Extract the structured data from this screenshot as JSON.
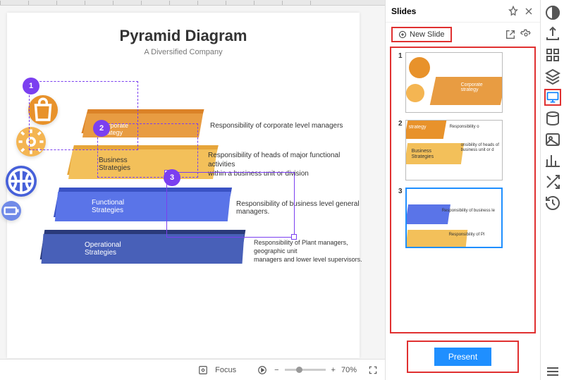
{
  "canvas": {
    "title": "Pyramid Diagram",
    "subtitle": "A Diversified Company",
    "levels": [
      {
        "label": "Corporate\nstrategy",
        "desc": "Responsibility of corporate level managers"
      },
      {
        "label": "Business\nStrategies",
        "desc": "Responsibility of heads of major functional activities\nwithin a business unit or division"
      },
      {
        "label": "Functional\nStrategies",
        "desc": "Responsibility of business level general managers."
      },
      {
        "label": "Operational\nStrategies",
        "desc": "Responsibility of Plant managers, geographic unit\nmanagers and lower level supervisors."
      }
    ],
    "selection_numbers": [
      "1",
      "2",
      "3"
    ]
  },
  "statusbar": {
    "focus_label": "Focus",
    "zoom_label": "70%"
  },
  "sidepanel": {
    "title": "Slides",
    "new_slide": "New Slide",
    "present_label": "Present",
    "thumbs": [
      {
        "num": "1",
        "t1_b1": "Corporate\nstrategy"
      },
      {
        "num": "2",
        "t2_b1": "strategy",
        "t2_b2": "Business\nStrategies",
        "t2_d1": "Responsibility o",
        "t2_d2": "onsibility of heads of\nbusiness unit or d"
      },
      {
        "num": "3",
        "t3_d1": "Responsibility of business le",
        "t3_d2": "Responsibility of Pl"
      }
    ]
  },
  "icons": {
    "bag": "bag",
    "gear": "gear",
    "basketball": "basketball",
    "battery": "battery",
    "pin": "pin",
    "close": "close",
    "share": "share",
    "settings": "settings",
    "diamond": "diamond",
    "export": "export",
    "grid": "grid",
    "layers": "layers",
    "slideshow": "slideshow",
    "db": "db",
    "image": "image",
    "unknown": "unknown",
    "shuffle": "shuffle",
    "history": "history",
    "menu": "menu"
  }
}
